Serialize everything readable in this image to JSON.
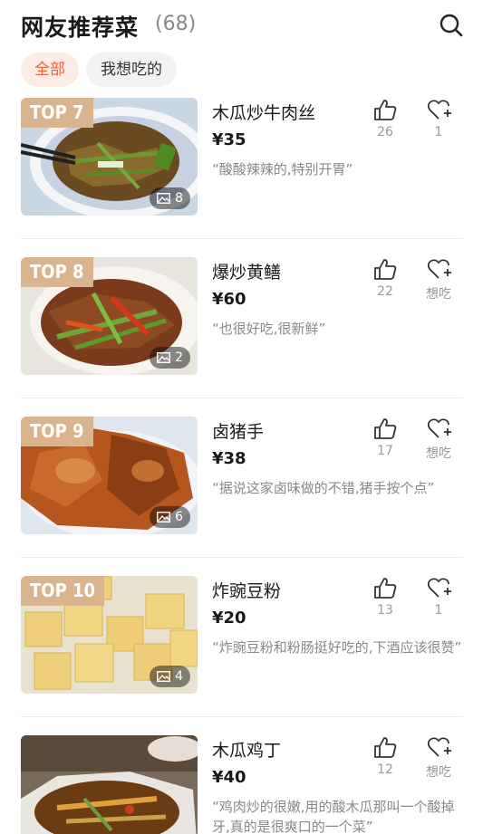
{
  "header": {
    "title": "网友推荐菜",
    "count": "(68)"
  },
  "filters": {
    "all": "全部",
    "want": "我想吃的"
  },
  "dishes": [
    {
      "rank": "TOP 7",
      "name": "木瓜炒牛肉丝",
      "price": "¥35",
      "quote": "“酸酸辣辣的,特别开胃”",
      "photos": "8",
      "likes": "26",
      "want": "1"
    },
    {
      "rank": "TOP 8",
      "name": "爆炒黄鳝",
      "price": "¥60",
      "quote": "“也很好吃,很新鲜”",
      "photos": "2",
      "likes": "22",
      "want": "想吃"
    },
    {
      "rank": "TOP 9",
      "name": "卤猪手",
      "price": "¥38",
      "quote": "“据说这家卤味做的不错,猪手按个点”",
      "photos": "6",
      "likes": "17",
      "want": "想吃"
    },
    {
      "rank": "TOP 10",
      "name": "炸豌豆粉",
      "price": "¥20",
      "quote": "“炸豌豆粉和粉肠挺好吃的,下酒应该很赞”",
      "photos": "4",
      "likes": "13",
      "want": "1"
    },
    {
      "rank": "",
      "name": "木瓜鸡丁",
      "price": "¥40",
      "quote": "“鸡肉炒的很嫩,用的酸木瓜那叫一个酸掉牙,真的是很爽口的一个菜”",
      "photos": "",
      "likes": "12",
      "want": "想吃"
    }
  ],
  "colors": {
    "accent": "#e8623a",
    "rank_badge": "#d9b48f"
  }
}
